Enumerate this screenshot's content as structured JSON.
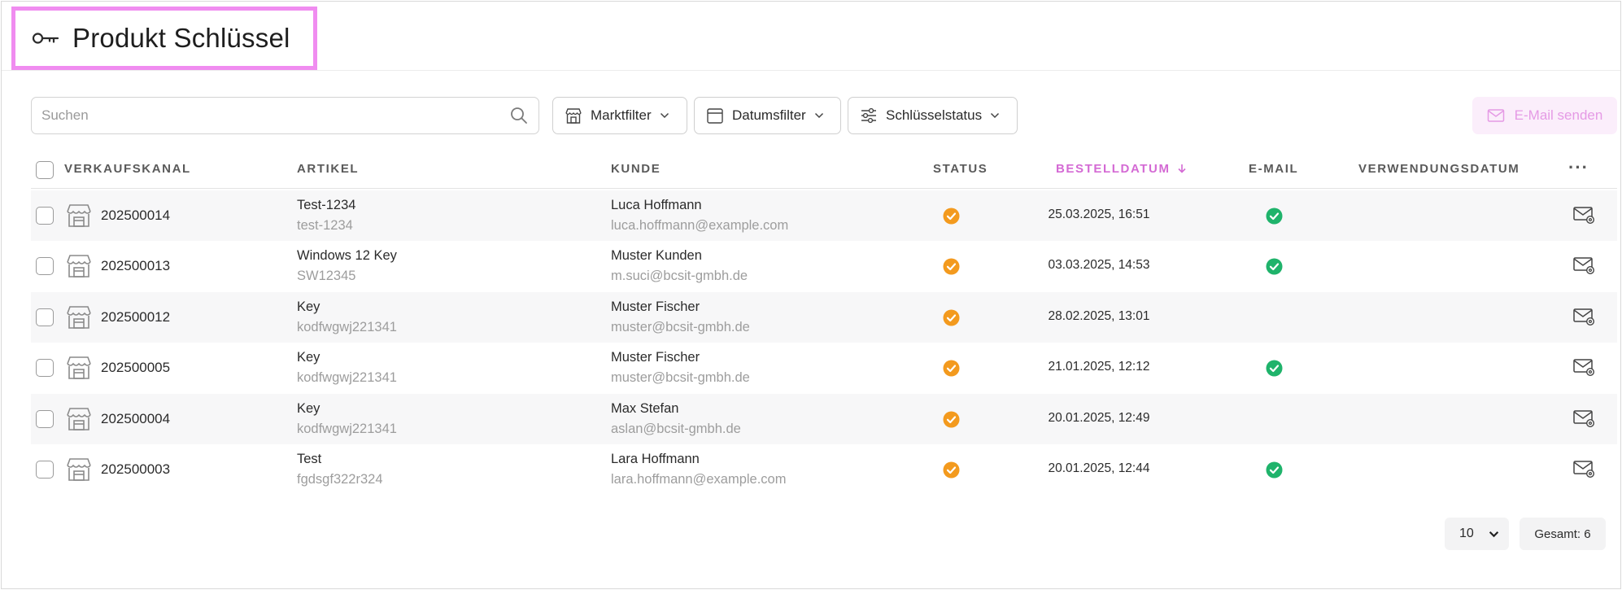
{
  "header": {
    "title": "Produkt Schlüssel",
    "icon": "key-icon"
  },
  "toolbar": {
    "search_placeholder": "Suchen",
    "market_filter": "Marktfilter",
    "date_filter": "Datumsfilter",
    "key_status": "Schlüsselstatus",
    "send_email": "E-Mail senden"
  },
  "table": {
    "columns": {
      "channel": "VERKAUFSKANAL",
      "article": "ARTIKEL",
      "customer": "KUNDE",
      "status": "STATUS",
      "order_date": "BESTELLDATUM",
      "email": "E-MAIL",
      "usage_date": "VERWENDUNGSDATUM",
      "more": "···"
    },
    "rows": [
      {
        "order": "202500014",
        "article": "Test-1234",
        "article_code": "test-1234",
        "customer": "Luca Hoffmann",
        "customer_email": "luca.hoffmann@example.com",
        "status": "pending",
        "date": "25.03.2025, 16:51",
        "email_sent": true
      },
      {
        "order": "202500013",
        "article": "Windows 12 Key",
        "article_code": "SW12345",
        "customer": "Muster Kunden",
        "customer_email": "m.suci@bcsit-gmbh.de",
        "status": "pending",
        "date": "03.03.2025, 14:53",
        "email_sent": true
      },
      {
        "order": "202500012",
        "article": "Key",
        "article_code": "kodfwgwj221341",
        "customer": "Muster Fischer",
        "customer_email": "muster@bcsit-gmbh.de",
        "status": "pending",
        "date": "28.02.2025, 13:01",
        "email_sent": false
      },
      {
        "order": "202500005",
        "article": "Key",
        "article_code": "kodfwgwj221341",
        "customer": "Muster Fischer",
        "customer_email": "muster@bcsit-gmbh.de",
        "status": "pending",
        "date": "21.01.2025, 12:12",
        "email_sent": true
      },
      {
        "order": "202500004",
        "article": "Key",
        "article_code": "kodfwgwj221341",
        "customer": "Max Stefan",
        "customer_email": "aslan@bcsit-gmbh.de",
        "status": "pending",
        "date": "20.01.2025, 12:49",
        "email_sent": false
      },
      {
        "order": "202500003",
        "article": "Test",
        "article_code": "fgdsgf322r324",
        "customer": "Lara Hoffmann",
        "customer_email": "lara.hoffmann@example.com",
        "status": "pending",
        "date": "20.01.2025, 12:44",
        "email_sent": true
      }
    ]
  },
  "footer": {
    "page_size": "10",
    "total": "Gesamt: 6"
  },
  "colors": {
    "accent": "#d46ad4",
    "status_pending": "#f39a1e",
    "status_ok": "#1fb36b",
    "highlight_border": "#f08cf0"
  }
}
